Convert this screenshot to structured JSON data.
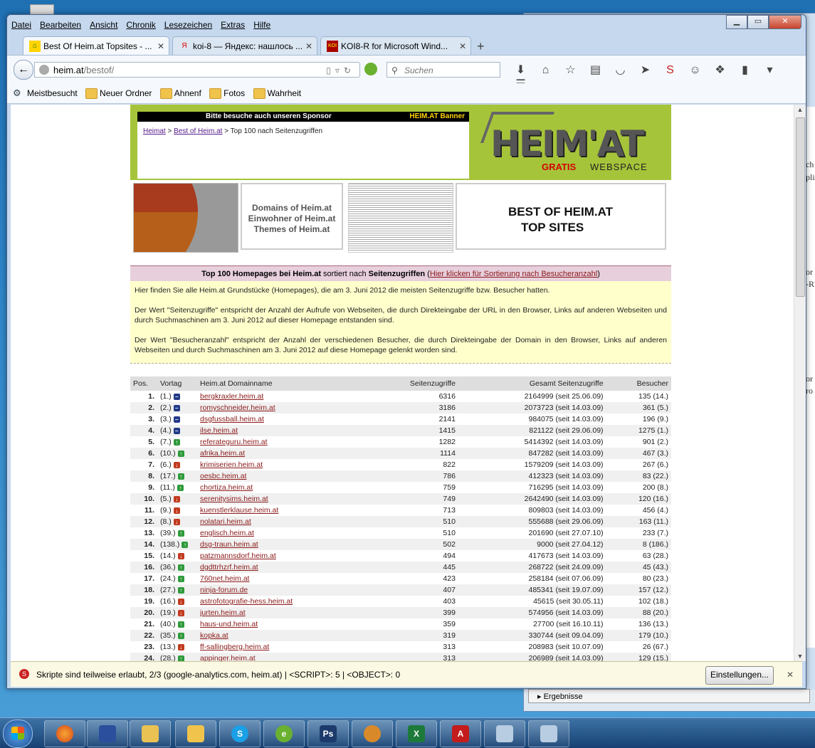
{
  "window": {
    "menu": [
      "Datei",
      "Bearbeiten",
      "Ansicht",
      "Chronik",
      "Lesezeichen",
      "Extras",
      "Hilfe"
    ],
    "tabs": [
      {
        "title": "Best Of Heim.at Topsites - ..."
      },
      {
        "title": "koi-8 — Яндекс: нашлось ..."
      },
      {
        "title": "KOI8-R for Microsoft Wind..."
      }
    ],
    "url_host": "heim.at",
    "url_path": "/bestof/",
    "search_placeholder": "Suchen",
    "bookmarks": [
      "Meistbesucht",
      "Neuer Ordner",
      "Ahnenf",
      "Fotos",
      "Wahrheit"
    ]
  },
  "page": {
    "sponsor_text": "Bitte besuche auch unseren Sponsor",
    "banner_label": "HEIM.AT Banner",
    "breadcrumb": {
      "home": "Heimat",
      "section": "Best of Heim.at",
      "current": "Top 100 nach Seitenzugriffen"
    },
    "logo": {
      "word": "HEIM'AT",
      "gratis": "GRATIS",
      "webspace": "WEBSPACE"
    },
    "links_tile": [
      "Domains of Heim.at",
      "Einwohner of Heim.at",
      "Themes of Heim.at"
    ],
    "best_title_1": "BEST OF HEIM.AT",
    "best_title_2": "TOP SITES",
    "header": {
      "bold": "Top 100 Homepages bei Heim.at",
      "mid": " sortiert nach ",
      "bold2": "Seitenzugriffen",
      "link": "Hier klicken für Sortierung nach Besucheranzahl"
    },
    "info": [
      "Hier finden Sie alle Heim.at Grundstücke (Homepages), die am 3. Juni 2012 die meisten Seitenzugriffe bzw. Besucher hatten.",
      "Der Wert \"Seitenzugriffe\" entspricht der Anzahl der Aufrufe von Webseiten, die durch Direkteingabe der URL in den Browser, Links auf anderen Webseiten und durch Suchmaschinen am 3. Juni 2012 auf dieser Homepage entstanden sind.",
      "Der Wert \"Besucheranzahl\" entspricht der Anzahl der verschiedenen Besucher, die durch Direkteingabe der Domain in den Browser, Links auf anderen Webseiten und durch Suchmaschinen am 3. Juni 2012 auf diese Homepage gelenkt worden sind."
    ],
    "columns": [
      "Pos.",
      "Vortag",
      "Heim.at Domainname",
      "Seitenzugriffe",
      "Gesamt Seitenzugriffe",
      "Besucher"
    ],
    "rows": [
      {
        "pos": "1.",
        "prev": "(1.)",
        "trend": "same",
        "domain": "bergkraxler.heim.at",
        "hits": "6316",
        "total": "2164999 (seit 25.06.09)",
        "visitors": "135 (14.)"
      },
      {
        "pos": "2.",
        "prev": "(2.)",
        "trend": "same",
        "domain": "romyschneider.heim.at",
        "hits": "3186",
        "total": "2073723 (seit 14.03.09)",
        "visitors": "361 (5.)"
      },
      {
        "pos": "3.",
        "prev": "(3.)",
        "trend": "same",
        "domain": "dsgfussball.heim.at",
        "hits": "2141",
        "total": "984075 (seit 14.03.09)",
        "visitors": "196 (9.)"
      },
      {
        "pos": "4.",
        "prev": "(4.)",
        "trend": "same",
        "domain": "ilse.heim.at",
        "hits": "1415",
        "total": "821122 (seit 29.06.09)",
        "visitors": "1275 (1.)"
      },
      {
        "pos": "5.",
        "prev": "(7.)",
        "trend": "up",
        "domain": "referateguru.heim.at",
        "hits": "1282",
        "total": "5414392 (seit 14.03.09)",
        "visitors": "901 (2.)"
      },
      {
        "pos": "6.",
        "prev": "(10.)",
        "trend": "up",
        "domain": "afrika.heim.at",
        "hits": "1114",
        "total": "847282 (seit 14.03.09)",
        "visitors": "467 (3.)"
      },
      {
        "pos": "7.",
        "prev": "(6.)",
        "trend": "down",
        "domain": "krimiserien.heim.at",
        "hits": "822",
        "total": "1579209 (seit 14.03.09)",
        "visitors": "267 (6.)"
      },
      {
        "pos": "8.",
        "prev": "(17.)",
        "trend": "up",
        "domain": "oesbc.heim.at",
        "hits": "786",
        "total": "412323 (seit 14.03.09)",
        "visitors": "83 (22.)"
      },
      {
        "pos": "9.",
        "prev": "(11.)",
        "trend": "up",
        "domain": "chortiza.heim.at",
        "hits": "759",
        "total": "716295 (seit 14.03.09)",
        "visitors": "200 (8.)"
      },
      {
        "pos": "10.",
        "prev": "(5.)",
        "trend": "down",
        "domain": "serenitysims.heim.at",
        "hits": "749",
        "total": "2642490 (seit 14.03.09)",
        "visitors": "120 (16.)"
      },
      {
        "pos": "11.",
        "prev": "(9.)",
        "trend": "down",
        "domain": "kuenstlerklause.heim.at",
        "hits": "713",
        "total": "809803 (seit 14.03.09)",
        "visitors": "456 (4.)"
      },
      {
        "pos": "12.",
        "prev": "(8.)",
        "trend": "down",
        "domain": "nolatari.heim.at",
        "hits": "510",
        "total": "555688 (seit 29.06.09)",
        "visitors": "163 (11.)"
      },
      {
        "pos": "13.",
        "prev": "(39.)",
        "trend": "up",
        "domain": "englisch.heim.at",
        "hits": "510",
        "total": "201690 (seit 27.07.10)",
        "visitors": "233 (7.)"
      },
      {
        "pos": "14.",
        "prev": "(138.)",
        "trend": "up",
        "domain": "dsg-traun.heim.at",
        "hits": "502",
        "total": "9000 (seit 27.04.12)",
        "visitors": "8 (186.)"
      },
      {
        "pos": "15.",
        "prev": "(14.)",
        "trend": "down",
        "domain": "patzmannsdorf.heim.at",
        "hits": "494",
        "total": "417673 (seit 14.03.09)",
        "visitors": "63 (28.)"
      },
      {
        "pos": "16.",
        "prev": "(36.)",
        "trend": "up",
        "domain": "dgdttrhzrf.heim.at",
        "hits": "445",
        "total": "268722 (seit 24.09.09)",
        "visitors": "45 (43.)"
      },
      {
        "pos": "17.",
        "prev": "(24.)",
        "trend": "up",
        "domain": "760net.heim.at",
        "hits": "423",
        "total": "258184 (seit 07.06.09)",
        "visitors": "80 (23.)"
      },
      {
        "pos": "18.",
        "prev": "(27.)",
        "trend": "up",
        "domain": "ninja-forum.de",
        "hits": "407",
        "total": "485341 (seit 19.07.09)",
        "visitors": "157 (12.)"
      },
      {
        "pos": "19.",
        "prev": "(16.)",
        "trend": "down",
        "domain": "astrofotografie-hess.heim.at",
        "hits": "403",
        "total": "45615 (seit 30.05.11)",
        "visitors": "102 (18.)"
      },
      {
        "pos": "20.",
        "prev": "(19.)",
        "trend": "down",
        "domain": "jurten.heim.at",
        "hits": "399",
        "total": "574956 (seit 14.03.09)",
        "visitors": "88 (20.)"
      },
      {
        "pos": "21.",
        "prev": "(40.)",
        "trend": "up",
        "domain": "haus-und.heim.at",
        "hits": "359",
        "total": "27700 (seit 16.10.11)",
        "visitors": "136 (13.)"
      },
      {
        "pos": "22.",
        "prev": "(35.)",
        "trend": "up",
        "domain": "kopka.at",
        "hits": "319",
        "total": "330744 (seit 09.04.09)",
        "visitors": "179 (10.)"
      },
      {
        "pos": "23.",
        "prev": "(13.)",
        "trend": "down",
        "domain": "ff-sallingberg.heim.at",
        "hits": "313",
        "total": "208983 (seit 10.07.09)",
        "visitors": "26 (67.)"
      },
      {
        "pos": "24.",
        "prev": "(28.)",
        "trend": "up",
        "domain": "appinger.heim.at",
        "hits": "313",
        "total": "206989 (seit 14.03.09)",
        "visitors": "129 (15.)"
      }
    ]
  },
  "notification": {
    "text": "Skripte sind teilweise erlaubt, 2/3 (google-analytics.com, heim.at) | <SCRIPT>: 5 | <OBJECT>: 0",
    "button": "Einstellungen..."
  },
  "background_window": {
    "results_label": "Ergebnisse"
  },
  "colors": {
    "banner_green": "#a6c43a",
    "link": "#8b1a1a",
    "header_pink": "#e7cfdc",
    "info_yellow": "#ffffcc"
  }
}
